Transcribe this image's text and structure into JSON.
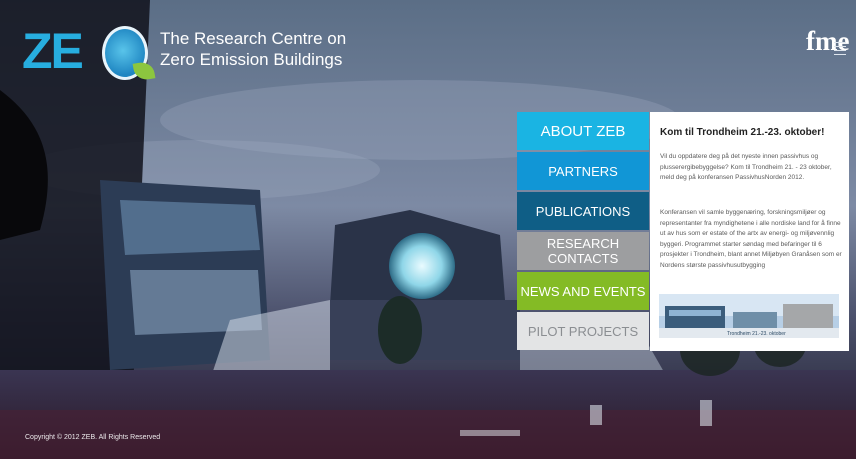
{
  "brand": {
    "logo_text": "ZE",
    "tagline_line1": "The Research Centre on",
    "tagline_line2": "Zero Emission Buildings",
    "partner_logo": "fme"
  },
  "nav": {
    "items": [
      {
        "label": "About ZEB"
      },
      {
        "label": "Partners"
      },
      {
        "label": "Publications"
      },
      {
        "label": "Research Contacts"
      },
      {
        "label": "News and Events"
      },
      {
        "label": "Pilot Projects"
      }
    ]
  },
  "news": {
    "title": "Kom til Trondheim 21.-23. oktober!",
    "paragraph1": "Vil du oppdatere deg på det nyeste innen passivhus og plusserergibebyggelse? Kom til Trondheim 21. - 23 oktober, meld deg på konferansen PassivhusNorden 2012.",
    "paragraph2": "Konferansen vil samle byggenæring, forskningsmiljøer og representanter fra myndighetene i alle nordiske land for å finne ut av hus som er estate of the artx av energi- og miljøvennlig byggeri. Programmet starter søndag med befaringer til 6 prosjekter i Trondheim, blant annet Miljøbyen Granåsen som er Nordens største passivhusutbygging",
    "banner_caption": "Trondheim 21.-23. oktober"
  },
  "footer": {
    "copyright": "Copyright © 2012 ZEB. All Rights Reserved"
  },
  "colors": {
    "about": "#1ab4e3",
    "partners": "#1196d6",
    "publications": "#0f5e86",
    "research": "#9d9ea0",
    "news": "#84bb25",
    "pilot": "#e3e4e5",
    "brand_blue": "#27aee0",
    "leaf_green": "#8cc63f"
  }
}
